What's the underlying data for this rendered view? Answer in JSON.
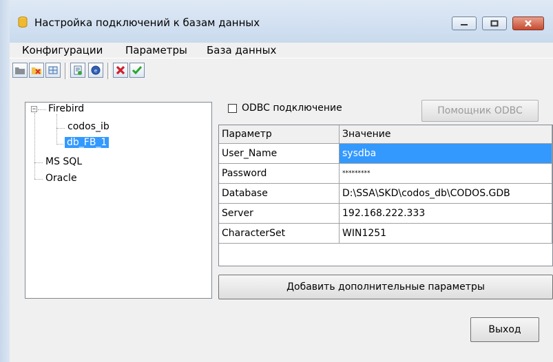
{
  "window": {
    "title": "Настройка подключений к базам данных"
  },
  "menu": [
    "Конфигурации",
    "Параметры",
    "База данных"
  ],
  "toolbar": {
    "buttons": [
      "open-db-icon",
      "delete-folder-icon",
      "connect-icon",
      "new-doc-icon",
      "test-connection-icon",
      "cancel-icon",
      "apply-icon"
    ]
  },
  "tree": {
    "root1": "Firebird",
    "child1": "codos_ib",
    "child2": "db_FB_1",
    "root2": "MS SQL",
    "root3": "Oracle",
    "expander": "−"
  },
  "odbc": {
    "label": "ODBC подключение",
    "checked": false,
    "helper_button": "Помощник ODBC"
  },
  "params": {
    "col1": "Параметр",
    "col2": "Значение",
    "rows": [
      {
        "name": "User_Name",
        "value": "sysdba"
      },
      {
        "name": "Password",
        "value": "*********"
      },
      {
        "name": "Database",
        "value": "D:\\SSA\\SKD\\codos_db\\CODOS.GDB"
      },
      {
        "name": "Server",
        "value": "192.168.222.333"
      },
      {
        "name": "CharacterSet",
        "value": "WIN1251"
      }
    ]
  },
  "buttons": {
    "add_params": "Добавить дополнительные параметры",
    "exit": "Выход"
  }
}
